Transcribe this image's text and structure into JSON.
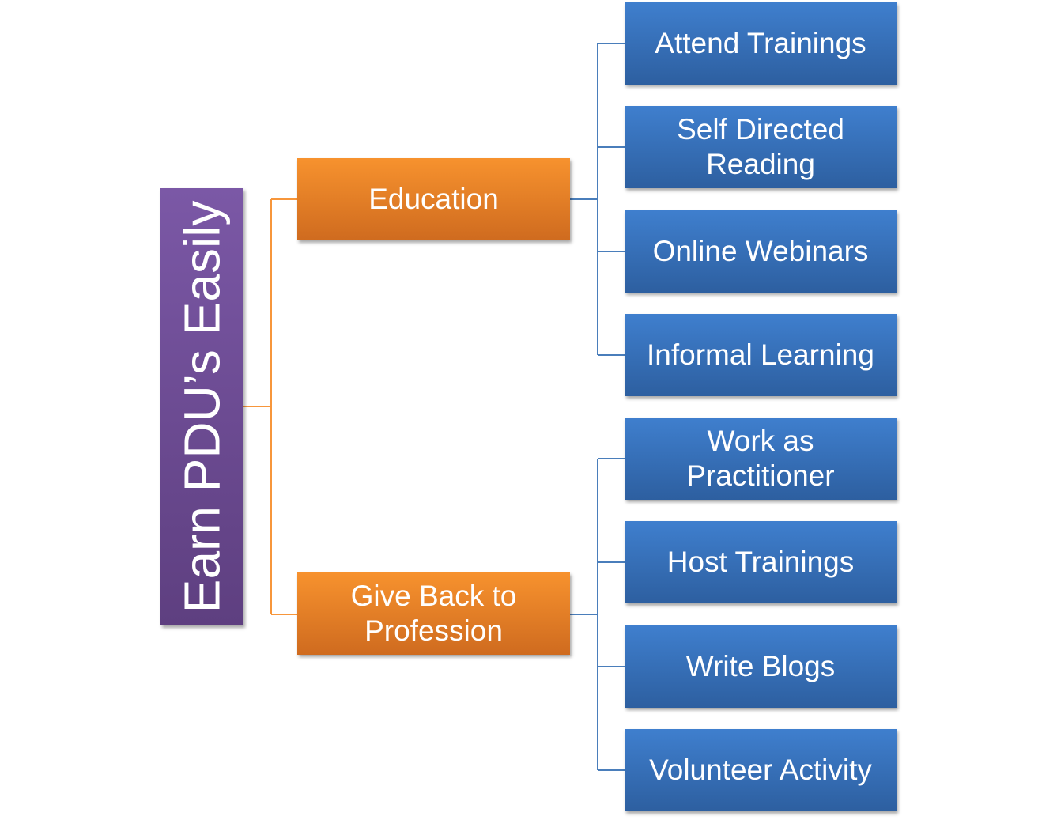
{
  "diagram": {
    "root": {
      "label": "Earn PDU’s Easily"
    },
    "categories": [
      {
        "label": "Education",
        "children": [
          "Attend Trainings",
          "Self Directed Reading",
          "Online Webinars",
          "Informal Learning"
        ]
      },
      {
        "label": "Give Back to Profession",
        "children": [
          "Work as Practitioner",
          "Host Trainings",
          "Write Blogs",
          "Volunteer Activity"
        ]
      }
    ],
    "colors": {
      "root": "#6a4a92",
      "category": "#ec8127",
      "leaf": "#3670b8",
      "root_connector": "#f7963b",
      "leaf_connector": "#4a7ebb"
    }
  }
}
